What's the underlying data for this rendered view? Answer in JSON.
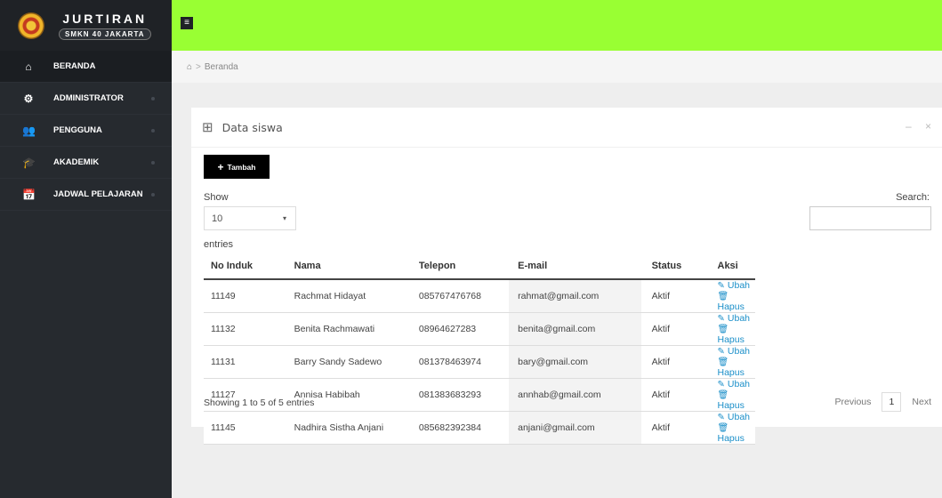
{
  "brand": {
    "title": "JURTIRAN",
    "subtitle": "SMKN 40 JAKARTA"
  },
  "topbar": {
    "toggle_icon": "hamburger-icon",
    "bg_color": "#99ff33"
  },
  "sidebar": {
    "items": [
      {
        "label": "BERANDA",
        "icon": "home-icon"
      },
      {
        "label": "ADMINISTRATOR",
        "icon": "gear-icon"
      },
      {
        "label": "PENGGUNA",
        "icon": "users-icon"
      },
      {
        "label": "AKADEMIK",
        "icon": "graduation-cap-icon"
      },
      {
        "label": "JADWAL PELAJARAN",
        "icon": "calendar-icon"
      }
    ]
  },
  "breadcrumb": {
    "home_icon": "home-icon",
    "sep": ">",
    "current": "Beranda"
  },
  "panel": {
    "title": "Data siswa",
    "minimize": "–",
    "close": "×",
    "add_button": "Tambah",
    "show_label": "Show",
    "length_value": "10",
    "entries_label": "entries",
    "search_label": "Search:"
  },
  "table": {
    "headers": [
      "No Induk",
      "Nama",
      "Telepon",
      "E-mail",
      "Status",
      "Aksi"
    ],
    "rows": [
      {
        "no": "11149",
        "nama": "Rachmat Hidayat",
        "telepon": "085767476768",
        "email": "rahmat@gmail.com",
        "status": "Aktif"
      },
      {
        "no": "11132",
        "nama": "Benita Rachmawati",
        "telepon": "08964627283",
        "email": "benita@gmail.com",
        "status": "Aktif"
      },
      {
        "no": "11131",
        "nama": "Barry Sandy Sadewo",
        "telepon": "081378463974",
        "email": "bary@gmail.com",
        "status": "Aktif"
      },
      {
        "no": "11127",
        "nama": "Annisa Habibah",
        "telepon": "081383683293",
        "email": "annhab@gmail.com",
        "status": "Aktif"
      },
      {
        "no": "11145",
        "nama": "Nadhira Sistha Anjani",
        "telepon": "085682392384",
        "email": "anjani@gmail.com",
        "status": "Aktif"
      }
    ],
    "edit_label": "Ubah",
    "delete_label": "Hapus"
  },
  "footer": {
    "info": "Showing 1 to 5 of 5 entries",
    "previous": "Previous",
    "page": "1",
    "next": "Next"
  }
}
